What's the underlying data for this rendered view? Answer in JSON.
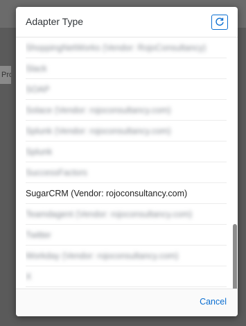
{
  "background": {
    "left_fragment": "Pro"
  },
  "dialog": {
    "title": "Adapter Type",
    "refresh_icon": "refresh-icon",
    "accent_color": "#0a6ed1",
    "items": [
      {
        "label": "ShoppingNetWorks (Vendor: RojoConsultancy)",
        "blurred": true
      },
      {
        "label": "Slack",
        "blurred": true
      },
      {
        "label": "SOAP",
        "blurred": true
      },
      {
        "label": "Solace (Vendor: rojoconsultancy.com)",
        "blurred": true
      },
      {
        "label": "Splunk (Vendor: rojoconsultancy.com)",
        "blurred": true
      },
      {
        "label": "Splunk",
        "blurred": true
      },
      {
        "label": "SuccessFactors",
        "blurred": true
      },
      {
        "label": "SugarCRM (Vendor: rojoconsultancy.com)",
        "blurred": false
      },
      {
        "label": "Teamdagent (Vendor: rojoconsultancy.com)",
        "blurred": true
      },
      {
        "label": "Twitter",
        "blurred": true
      },
      {
        "label": "Workday (Vendor: rojoconsultancy.com)",
        "blurred": true
      },
      {
        "label": "X",
        "blurred": true
      }
    ],
    "cancel_label": "Cancel"
  }
}
